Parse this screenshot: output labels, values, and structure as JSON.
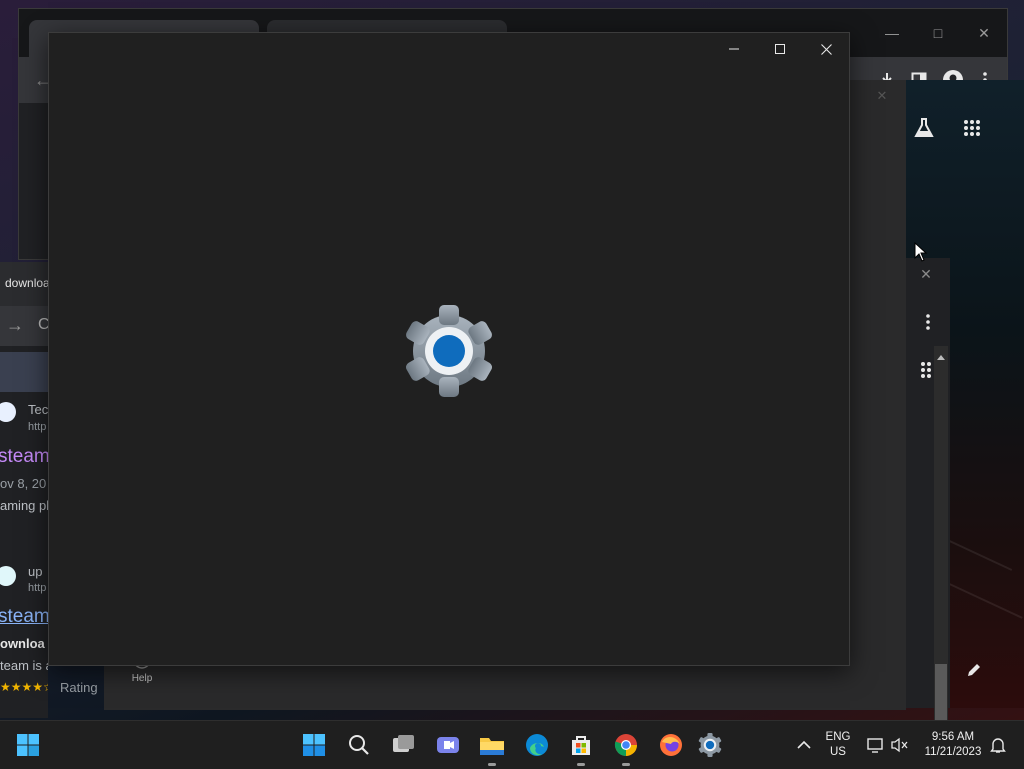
{
  "desktop": {},
  "background_browser": {
    "tab_count": 2
  },
  "left_browser": {
    "tab_title": "downloa",
    "snippets": [
      {
        "text": "Tec",
        "class": "site"
      },
      {
        "text": "http",
        "class": "url"
      },
      {
        "text": "steam",
        "class": "link"
      },
      {
        "text": "ov 8, 20",
        "class": "date"
      },
      {
        "text": "aming pl",
        "class": "desc"
      },
      {
        "text": "up",
        "class": "site"
      },
      {
        "text": "http",
        "class": "url"
      },
      {
        "text": "steam",
        "class": "link"
      },
      {
        "text": "ownloa",
        "class": "bold"
      },
      {
        "text": "team is a gaming",
        "class": "desc"
      },
      {
        "text": "Rating",
        "class": "rating"
      }
    ]
  },
  "settings_window": {
    "loading": true,
    "controls": {
      "minimize": "minimize",
      "maximize": "maximize",
      "close": "close"
    }
  },
  "help": {
    "label": "Help"
  },
  "taskbar": {
    "apps": [
      {
        "name": "start",
        "icon": "windows-start-icon"
      },
      {
        "name": "search",
        "icon": "search-icon"
      },
      {
        "name": "task-view",
        "icon": "task-view-icon"
      },
      {
        "name": "teams-chat",
        "icon": "video-chat-icon"
      },
      {
        "name": "file-explorer",
        "icon": "folder-icon"
      },
      {
        "name": "edge",
        "icon": "edge-icon"
      },
      {
        "name": "store",
        "icon": "store-icon"
      },
      {
        "name": "chrome",
        "icon": "chrome-icon"
      },
      {
        "name": "firefox",
        "icon": "firefox-icon"
      },
      {
        "name": "settings",
        "icon": "settings-gear-icon"
      }
    ],
    "tray": {
      "language": "ENG",
      "region": "US",
      "time": "9:56 AM",
      "date": "11/21/2023"
    }
  },
  "colors": {
    "accent": "#0f6cbd",
    "window_bg": "#202020",
    "taskbar_bg": "#1f1f1f"
  }
}
